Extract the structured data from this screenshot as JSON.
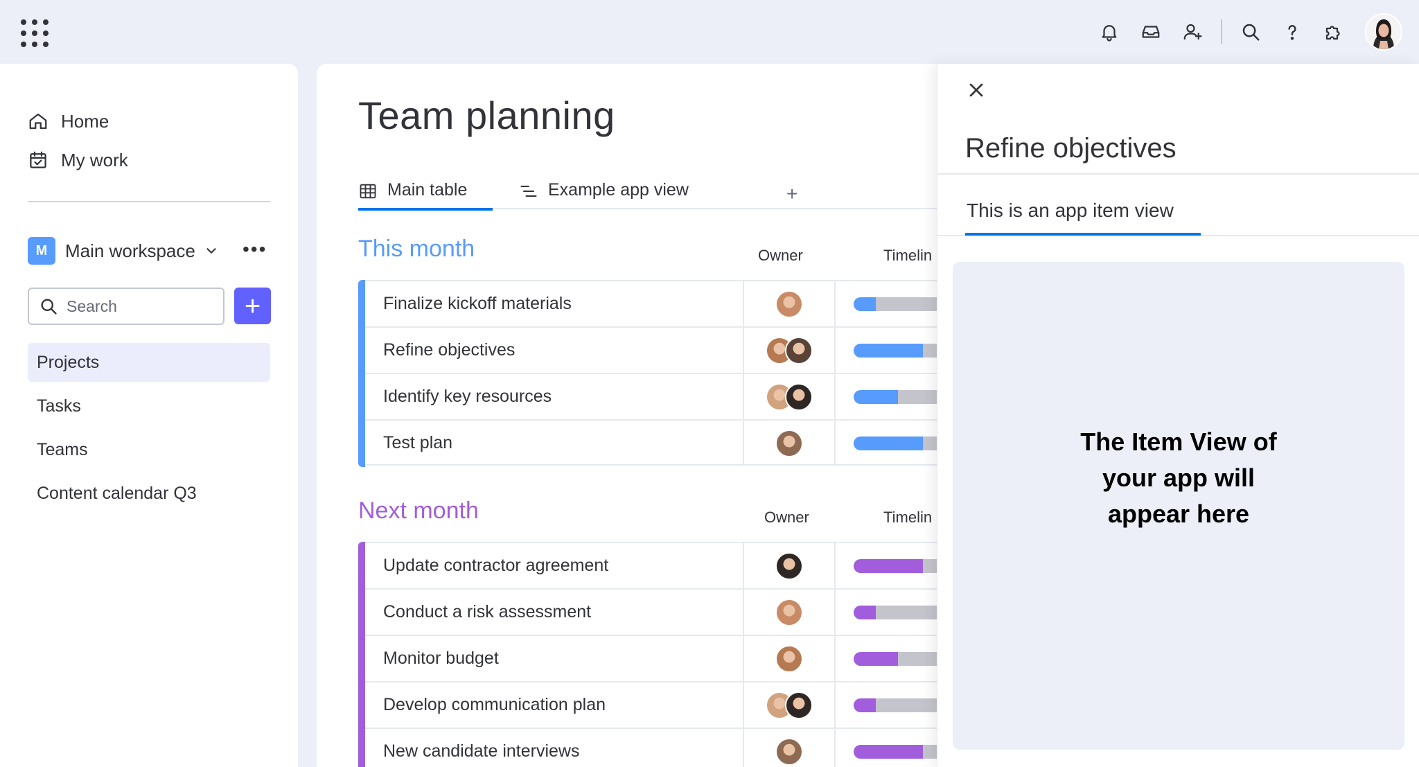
{
  "topbar": {
    "icons": [
      "apps-grid-icon",
      "bell-icon",
      "inbox-icon",
      "invite-user-icon",
      "search-icon",
      "help-icon",
      "puzzle-icon"
    ]
  },
  "sidebar": {
    "nav": [
      {
        "label": "Home",
        "icon": "home-icon"
      },
      {
        "label": "My work",
        "icon": "calendar-check-icon"
      }
    ],
    "workspace": {
      "badge": "M",
      "name": "Main workspace",
      "more": "•••"
    },
    "search": {
      "placeholder": "Search"
    },
    "add_button": "+",
    "boards": [
      {
        "label": "Projects",
        "active": true
      },
      {
        "label": "Tasks",
        "active": false
      },
      {
        "label": "Teams",
        "active": false
      },
      {
        "label": "Content calendar Q3",
        "active": false
      }
    ]
  },
  "main": {
    "title": "Team planning",
    "tabs": [
      {
        "label": "Main table",
        "icon": "table-icon",
        "active": true
      },
      {
        "label": "Example app view",
        "icon": "app-view-icon",
        "active": false
      }
    ],
    "add_tab": "+",
    "groups": [
      {
        "title": "This month",
        "color": "#579bfc",
        "columns": {
          "owner": "Owner",
          "timeline": "Timelin"
        },
        "rows": [
          {
            "name": "Finalize kickoff materials",
            "owners": 1,
            "progress": 0.16
          },
          {
            "name": "Refine objectives",
            "owners": 2,
            "progress": 0.5
          },
          {
            "name": "Identify key resources",
            "owners": 2,
            "progress": 0.32
          },
          {
            "name": "Test plan",
            "owners": 1,
            "progress": 0.5
          }
        ]
      },
      {
        "title": "Next month",
        "color": "#a25ddc",
        "columns": {
          "owner": "Owner",
          "timeline": "Timelin"
        },
        "rows": [
          {
            "name": "Update contractor agreement",
            "owners": 1,
            "progress": 0.5
          },
          {
            "name": "Conduct a risk assessment",
            "owners": 1,
            "progress": 0.16
          },
          {
            "name": "Monitor budget",
            "owners": 1,
            "progress": 0.32
          },
          {
            "name": "Develop communication plan",
            "owners": 2,
            "progress": 0.16
          },
          {
            "name": "New candidate interviews",
            "owners": 1,
            "progress": 0.5
          }
        ]
      }
    ]
  },
  "panel": {
    "title": "Refine objectives",
    "tab_label": "This is an app item view",
    "placeholder": "The Item View of your app will appear here"
  },
  "colors": {
    "primary": "#0073ea",
    "add_button": "#6161ff",
    "this_month": "#579bfc",
    "next_month": "#a25ddc",
    "timeline_track": "#c4c4cc"
  }
}
